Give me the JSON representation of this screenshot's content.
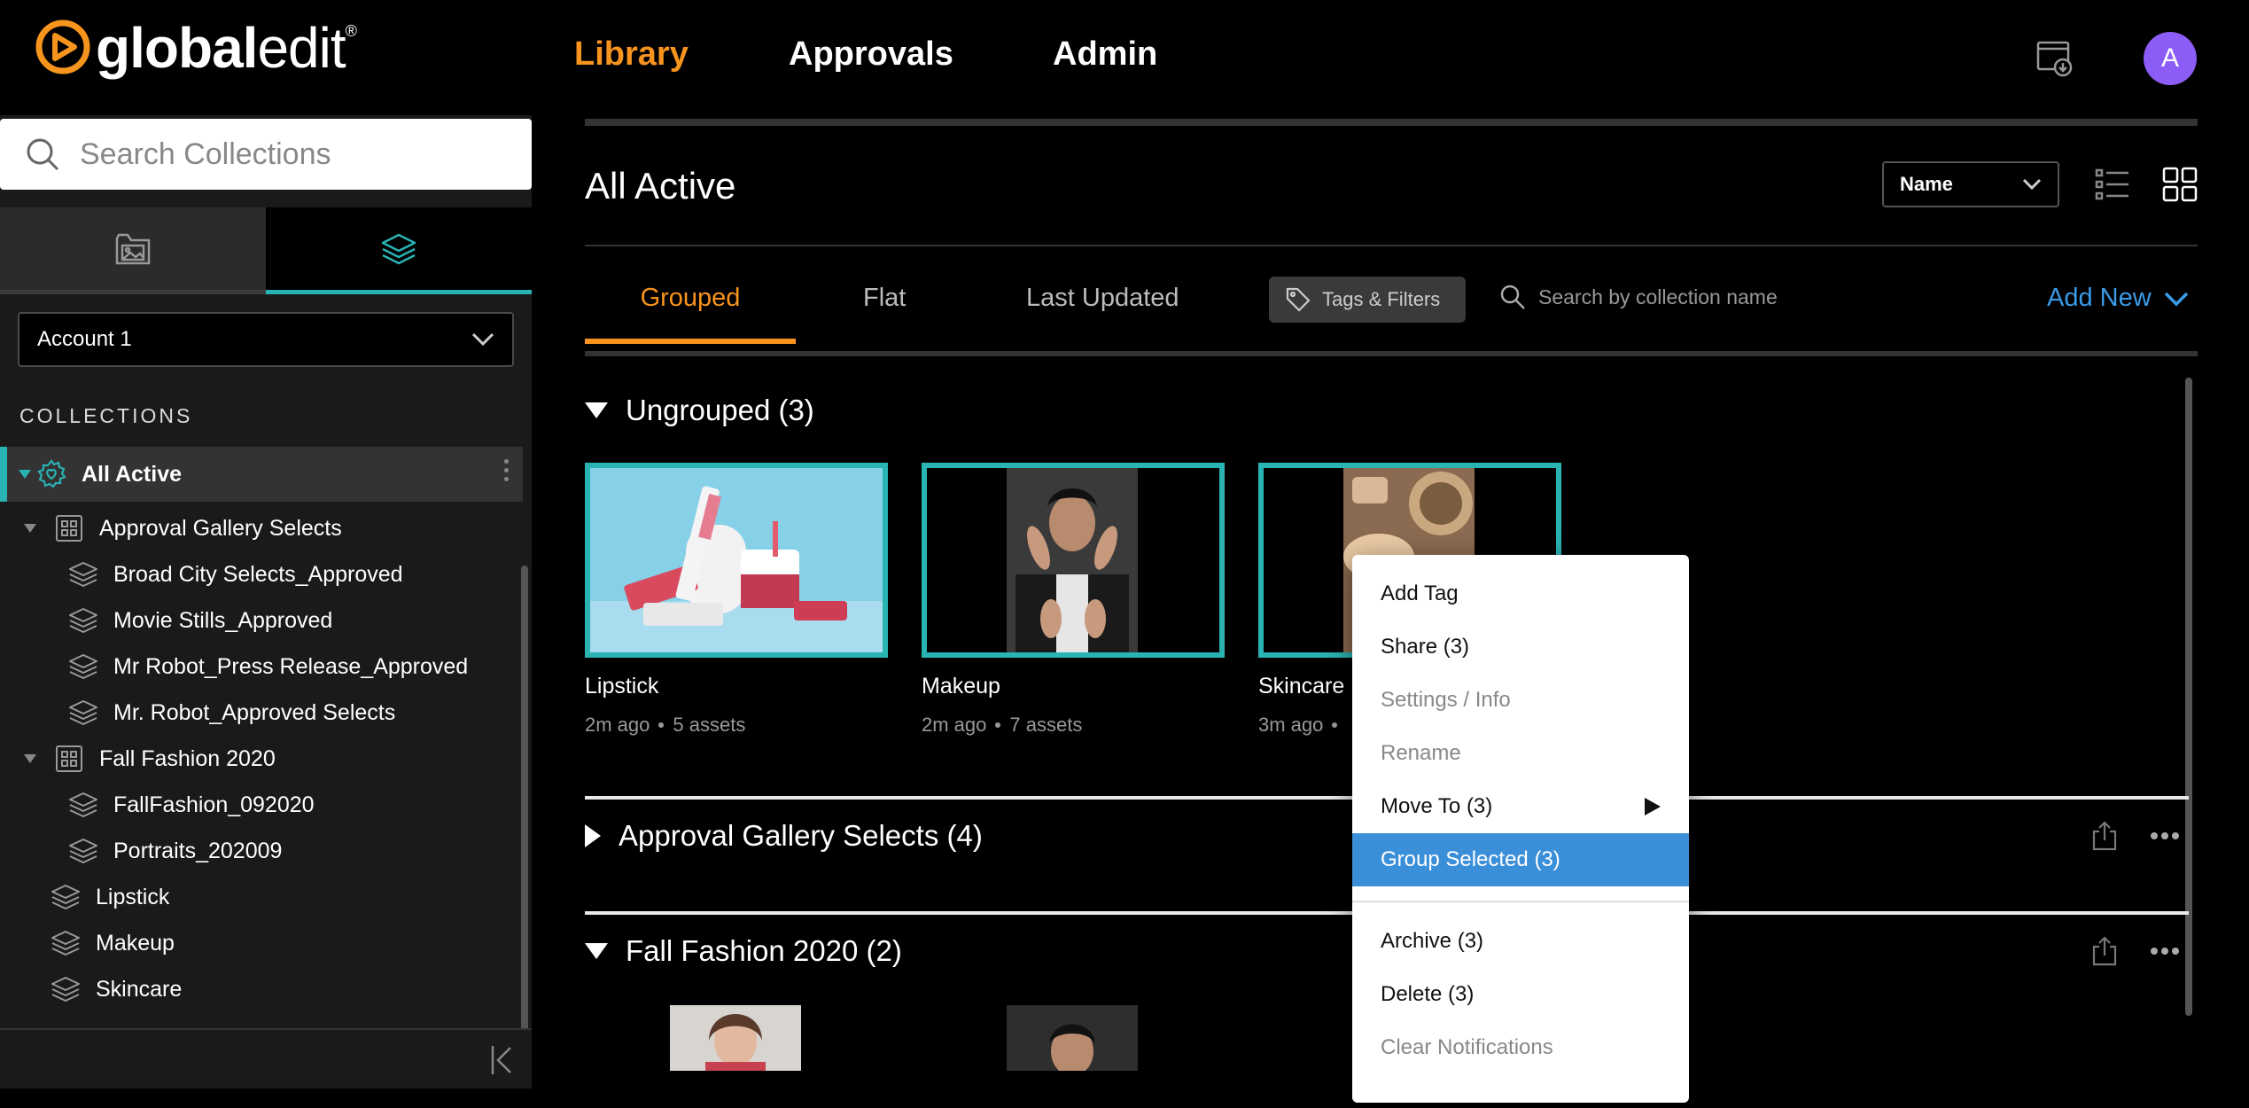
{
  "brand": {
    "name_bold": "global",
    "name_light": "edit",
    "mark": "®"
  },
  "nav": {
    "library": "Library",
    "approvals": "Approvals",
    "admin": "Admin"
  },
  "user": {
    "initial": "A",
    "avatar_color": "#8b5cf6"
  },
  "colors": {
    "accent_orange": "#f7941d",
    "accent_teal": "#2ab3b3",
    "link_blue": "#3b9be8",
    "menu_highlight": "#3b8fd8"
  },
  "sidebar": {
    "search_placeholder": "Search Collections",
    "account": "Account 1",
    "collections_label": "COLLECTIONS",
    "items": [
      {
        "label": "All Active",
        "level": 0,
        "selected": true,
        "icon": "gear-heart-icon"
      },
      {
        "label": "Approval Gallery Selects",
        "level": 0,
        "icon": "gallery-group-icon"
      },
      {
        "label": "Broad City Selects_Approved",
        "level": 1,
        "icon": "layers-icon"
      },
      {
        "label": "Movie Stills_Approved",
        "level": 1,
        "icon": "layers-icon"
      },
      {
        "label": "Mr Robot_Press Release_Approved",
        "level": 1,
        "icon": "layers-icon"
      },
      {
        "label": "Mr. Robot_Approved Selects",
        "level": 1,
        "icon": "layers-icon"
      },
      {
        "label": "Fall Fashion 2020",
        "level": 0,
        "icon": "gallery-group-icon"
      },
      {
        "label": "FallFashion_092020",
        "level": 1,
        "icon": "layers-icon"
      },
      {
        "label": "Portraits_202009",
        "level": 1,
        "icon": "layers-icon"
      },
      {
        "label": "Lipstick",
        "level": 0,
        "icon": "layers-icon"
      },
      {
        "label": "Makeup",
        "level": 0,
        "icon": "layers-icon"
      },
      {
        "label": "Skincare",
        "level": 0,
        "icon": "layers-icon"
      }
    ]
  },
  "main": {
    "title": "All Active",
    "sort": "Name",
    "tabs": [
      "Grouped",
      "Flat",
      "Last Updated"
    ],
    "tags_filters": "Tags & Filters",
    "search_placeholder": "Search by collection name",
    "add_new": "Add New",
    "groups": [
      {
        "title": "Ungrouped (3)",
        "expanded": true
      },
      {
        "title": "Approval Gallery Selects (4)",
        "expanded": false
      },
      {
        "title": "Fall Fashion 2020 (2)",
        "expanded": true
      }
    ],
    "cards": [
      {
        "name": "Lipstick",
        "age": "2m ago",
        "assets": "5 assets"
      },
      {
        "name": "Makeup",
        "age": "2m ago",
        "assets": "7 assets"
      },
      {
        "name": "Skincare",
        "age": "3m ago"
      }
    ]
  },
  "context_menu": {
    "items": [
      {
        "label": "Add Tag"
      },
      {
        "label": "Share (3)"
      },
      {
        "label": "Settings / Info",
        "disabled": true
      },
      {
        "label": "Rename",
        "disabled": true
      },
      {
        "label": "Move To (3)",
        "submenu": true
      },
      {
        "label": "Group Selected (3)",
        "highlight": true
      },
      {
        "label": "Archive (3)"
      },
      {
        "label": "Delete (3)"
      },
      {
        "label": "Clear Notifications",
        "disabled": true
      }
    ]
  }
}
